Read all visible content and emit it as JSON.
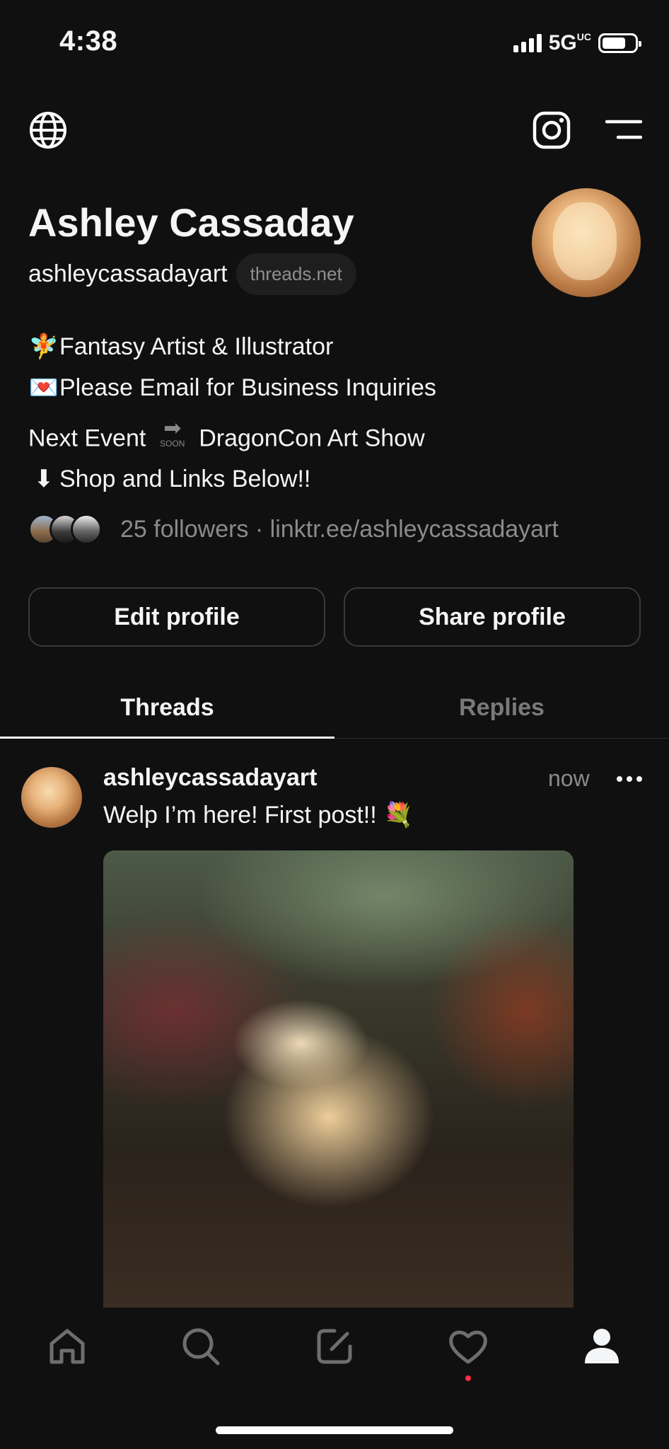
{
  "status_bar": {
    "time": "4:38",
    "network": "5G",
    "network_superscript": "UC"
  },
  "profile": {
    "name": "Ashley Cassaday",
    "handle": "ashleycassadayart",
    "domain_chip": "threads.net",
    "bio": [
      {
        "icon": "fairy-emoji",
        "glyph": "🧚",
        "text": "Fantasy Artist & Illustrator"
      },
      {
        "icon": "love-letter-emoji",
        "glyph": "💌",
        "text": "Please Email for Business Inquiries"
      },
      {
        "prefix": "Next Event",
        "icon": "soon-arrow-emoji",
        "glyph": "➡",
        "glyph_label": "SOON",
        "text": "DragonCon Art Show"
      },
      {
        "icon": "down-arrow-emoji",
        "glyph": "⬇",
        "text": "Shop and Links Below!!"
      }
    ],
    "followers_text": "25 followers · linktr.ee/ashleycassadayart"
  },
  "buttons": {
    "edit_profile": "Edit profile",
    "share_profile": "Share profile"
  },
  "tabs": [
    {
      "label": "Threads",
      "active": true
    },
    {
      "label": "Replies",
      "active": false
    }
  ],
  "post": {
    "username": "ashleycassadayart",
    "time": "now",
    "text": "Welp I’m here! First post!! 💐",
    "image_alt": "fantasy painting"
  },
  "bottom_nav": [
    "home-icon",
    "search-icon",
    "compose-icon",
    "activity-heart-icon",
    "profile-icon"
  ],
  "colors": {
    "background": "#101010",
    "text": "#f3f5f7",
    "muted": "#8b8b8b",
    "notification_dot": "#ff3040"
  }
}
